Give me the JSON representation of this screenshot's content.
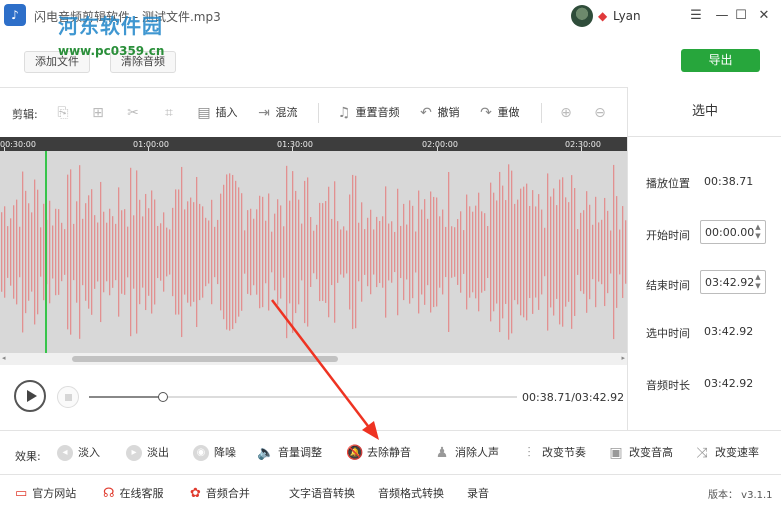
{
  "window": {
    "title": "闪电音频剪辑软件 - 测试文件.mp3",
    "user_name": "Lyan",
    "minimize": "—",
    "maximize": "☐",
    "close": "✕",
    "menu": "☰"
  },
  "watermark": {
    "text": "河东软件园",
    "url": "www.pc0359.cn"
  },
  "top_buttons": {
    "add_file": "添加文件",
    "clear_audio": "清除音频",
    "export": "导出"
  },
  "toolbar": {
    "label": "剪辑:",
    "insert": "插入",
    "mix": "混流",
    "reset_audio": "重置音频",
    "undo": "撤销",
    "redo": "重做"
  },
  "timeline": {
    "ticks": [
      "00:30:00",
      "01:00:00",
      "01:30:00",
      "02:00:00",
      "02:30:00"
    ]
  },
  "selection_panel": {
    "title": "选中",
    "play_position_label": "播放位置",
    "play_position": "00:38.71",
    "start_label": "开始时间",
    "start_time": "00:00.00",
    "end_label": "结束时间",
    "end_time": "03:42.92",
    "selected_label": "选中时间",
    "selected_time": "03:42.92",
    "duration_label": "音频时长",
    "duration": "03:42.92"
  },
  "player": {
    "time_display": "00:38.71/03:42.92",
    "progress": 0.174
  },
  "effects": {
    "label": "效果:",
    "items": [
      "淡入",
      "淡出",
      "降噪",
      "音量调整",
      "去除静音",
      "消除人声",
      "改变节奏",
      "改变音高",
      "改变速率"
    ]
  },
  "bottom_bar": {
    "website": "官方网站",
    "support": "在线客服",
    "merge": "音频合并",
    "tts": "文字语音转换",
    "format": "音频格式转换",
    "record": "录音",
    "version": "版本： v3.1.1"
  },
  "colors": {
    "accent_green": "#27a63c",
    "waveform": "#e29090",
    "annotation": "#ee3322"
  }
}
